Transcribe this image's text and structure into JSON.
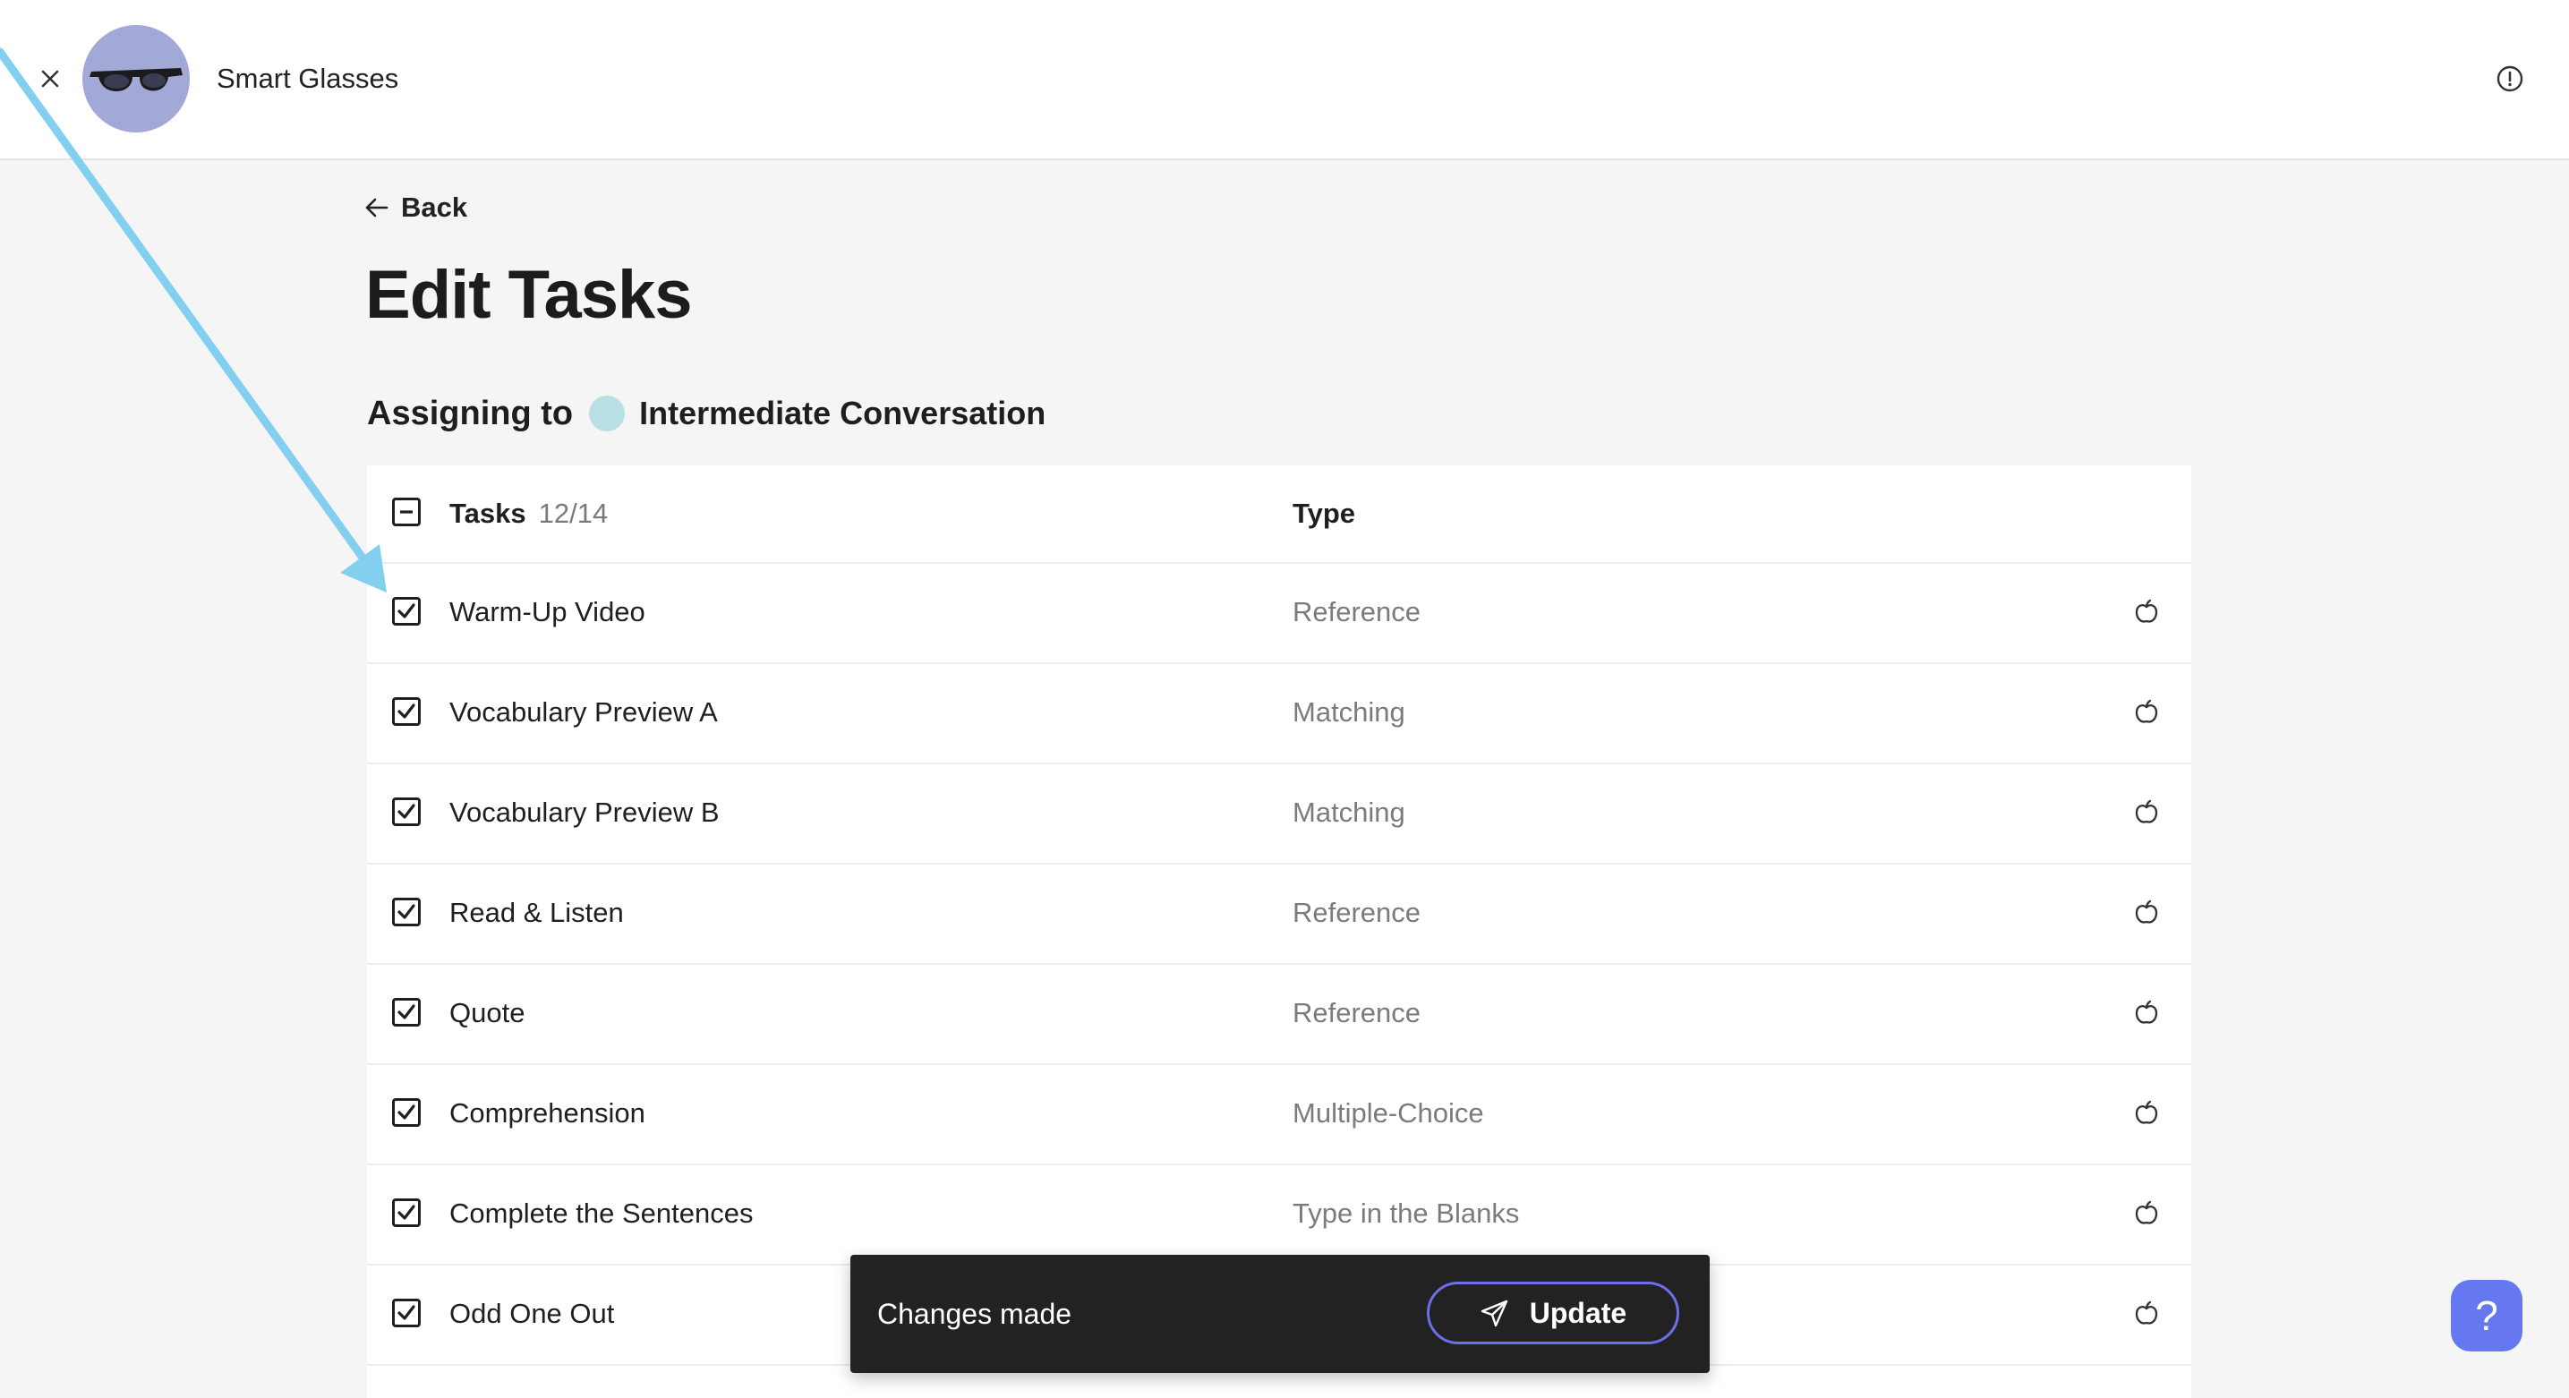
{
  "header": {
    "product_name": "Smart Glasses",
    "close_icon": "close-icon",
    "info_icon": "info-icon",
    "avatar_color": "#a3a9d6"
  },
  "main": {
    "back_label": "Back",
    "title": "Edit Tasks",
    "assign_label": "Assigning to",
    "class_name": "Intermediate Conversation",
    "class_color": "#b7dfe4"
  },
  "table": {
    "header_tasks": "Tasks",
    "header_count": "12/14",
    "header_type": "Type",
    "rows": [
      {
        "name": "Warm-Up Video",
        "type": "Reference",
        "checked": true
      },
      {
        "name": "Vocabulary Preview A",
        "type": "Matching",
        "checked": true
      },
      {
        "name": "Vocabulary Preview B",
        "type": "Matching",
        "checked": true
      },
      {
        "name": "Read & Listen",
        "type": "Reference",
        "checked": true
      },
      {
        "name": "Quote",
        "type": "Reference",
        "checked": true
      },
      {
        "name": "Comprehension",
        "type": "Multiple-Choice",
        "checked": true
      },
      {
        "name": "Complete the Sentences",
        "type": "Type in the Blanks",
        "checked": true
      },
      {
        "name": "Odd One Out",
        "type": "",
        "checked": true
      }
    ]
  },
  "toast": {
    "message": "Changes made",
    "update_label": "Update"
  },
  "help": {
    "label": "?",
    "color": "#6578f0"
  },
  "annotation": {
    "arrow_color": "#82cff0"
  }
}
